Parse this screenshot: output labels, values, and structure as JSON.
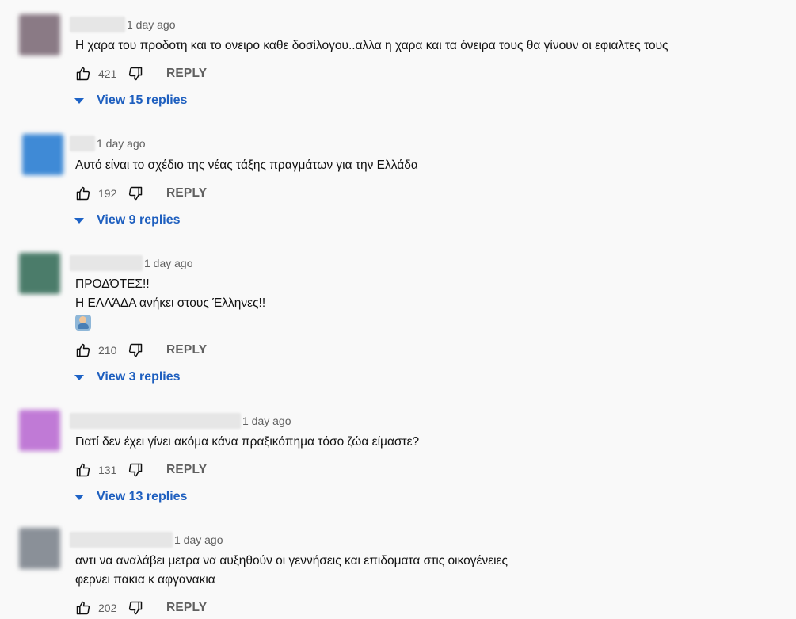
{
  "comments": [
    {
      "avatar_color": "#8a7a85",
      "timestamp": "1 day ago",
      "lines": [
        "Η χαρα του προδοτη και το ονειρο καθε δοσίλογου..αλλα η χαρα και τα όνειρα τους θα γίνουν οι εφιαλτες τους"
      ],
      "likes": "421",
      "reply_label": "REPLY",
      "view_replies": "View 15 replies"
    },
    {
      "avatar_color": "#3f8ad6",
      "timestamp": "1 day ago",
      "lines": [
        "Αυτό είναι το σχέδιο της νέας τάξης πραγμάτων για την Ελλάδα"
      ],
      "likes": "192",
      "reply_label": "REPLY",
      "view_replies": "View 9 replies"
    },
    {
      "avatar_color": "#4b7c6a",
      "timestamp": "1 day ago",
      "lines": [
        "ΠΡΟΔΌΤΕΣ!!",
        "Η ΕΛΛΆΔΑ ανήκει στους Έλληνες!!"
      ],
      "emoji": "person-raising-hand-emoji",
      "likes": "210",
      "reply_label": "REPLY",
      "view_replies": "View 3 replies"
    },
    {
      "avatar_color": "#c07ad6",
      "timestamp": "1 day ago",
      "lines": [
        "Γιατί δεν έχει γίνει ακόμα κάνα πραξικόπημα τόσο ζώα είμαστε?"
      ],
      "likes": "131",
      "reply_label": "REPLY",
      "view_replies": "View 13 replies"
    },
    {
      "avatar_color": "#8a9098",
      "timestamp": "1 day ago",
      "lines": [
        "αντι να αναλάβει μετρα να αυξηθούν οι γεννήσεις και επιδοματα στις οικογένειες",
        "φερνει πακια κ αφγανακια"
      ],
      "likes": "202",
      "reply_label": "REPLY",
      "view_replies": ""
    }
  ],
  "colors": {
    "link_blue": "#065fd4",
    "meta_gray": "#606060",
    "background": "#f9f9f9"
  }
}
